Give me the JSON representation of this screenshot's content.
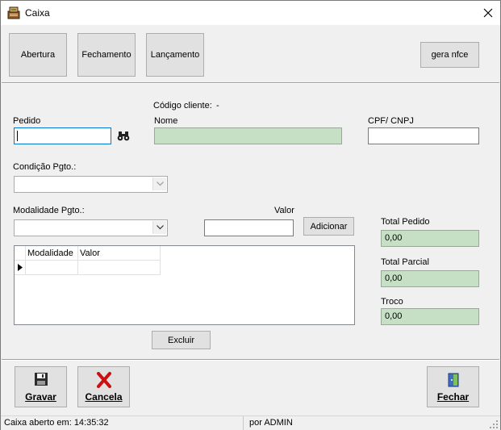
{
  "window": {
    "title": "Caixa"
  },
  "toolbar": {
    "abertura": "Abertura",
    "fechamento": "Fechamento",
    "lancamento": "Lançamento",
    "gera_nfce": "gera nfce"
  },
  "form": {
    "codigo_cliente_label": "Código cliente:",
    "codigo_cliente_value": "-",
    "pedido_label": "Pedido",
    "pedido_value": "",
    "nome_label": "Nome",
    "nome_value": "",
    "cpf_label": "CPF/ CNPJ",
    "cpf_value": "",
    "condicao_label": "Condição Pgto.:",
    "condicao_value": "",
    "modalidade_label": "Modalidade Pgto.:",
    "modalidade_value": "",
    "valor_label": "Valor",
    "valor_value": "",
    "adicionar": "Adicionar",
    "excluir": "Excluir"
  },
  "grid": {
    "columns": [
      "Modalidade",
      "Valor"
    ],
    "rows": [
      [
        "",
        ""
      ]
    ]
  },
  "totals": {
    "total_pedido_label": "Total Pedido",
    "total_pedido_value": "0,00",
    "total_parcial_label": "Total Parcial",
    "total_parcial_value": "0,00",
    "troco_label": "Troco",
    "troco_value": "0,00"
  },
  "actions": {
    "gravar": "Gravar",
    "cancela": "Cancela",
    "fechar": "Fechar"
  },
  "status": {
    "left": "Caixa aberto em: 14:35:32",
    "right": "por ADMIN"
  },
  "icons": {
    "app": "cash-register-icon",
    "search": "binoculars-icon",
    "gravar": "floppy-disk-icon",
    "cancela": "red-x-icon",
    "fechar": "exit-door-icon"
  },
  "colors": {
    "readonly_green": "#c6e0c6",
    "focus_blue": "#0078d7",
    "cancel_red": "#cc1010"
  }
}
